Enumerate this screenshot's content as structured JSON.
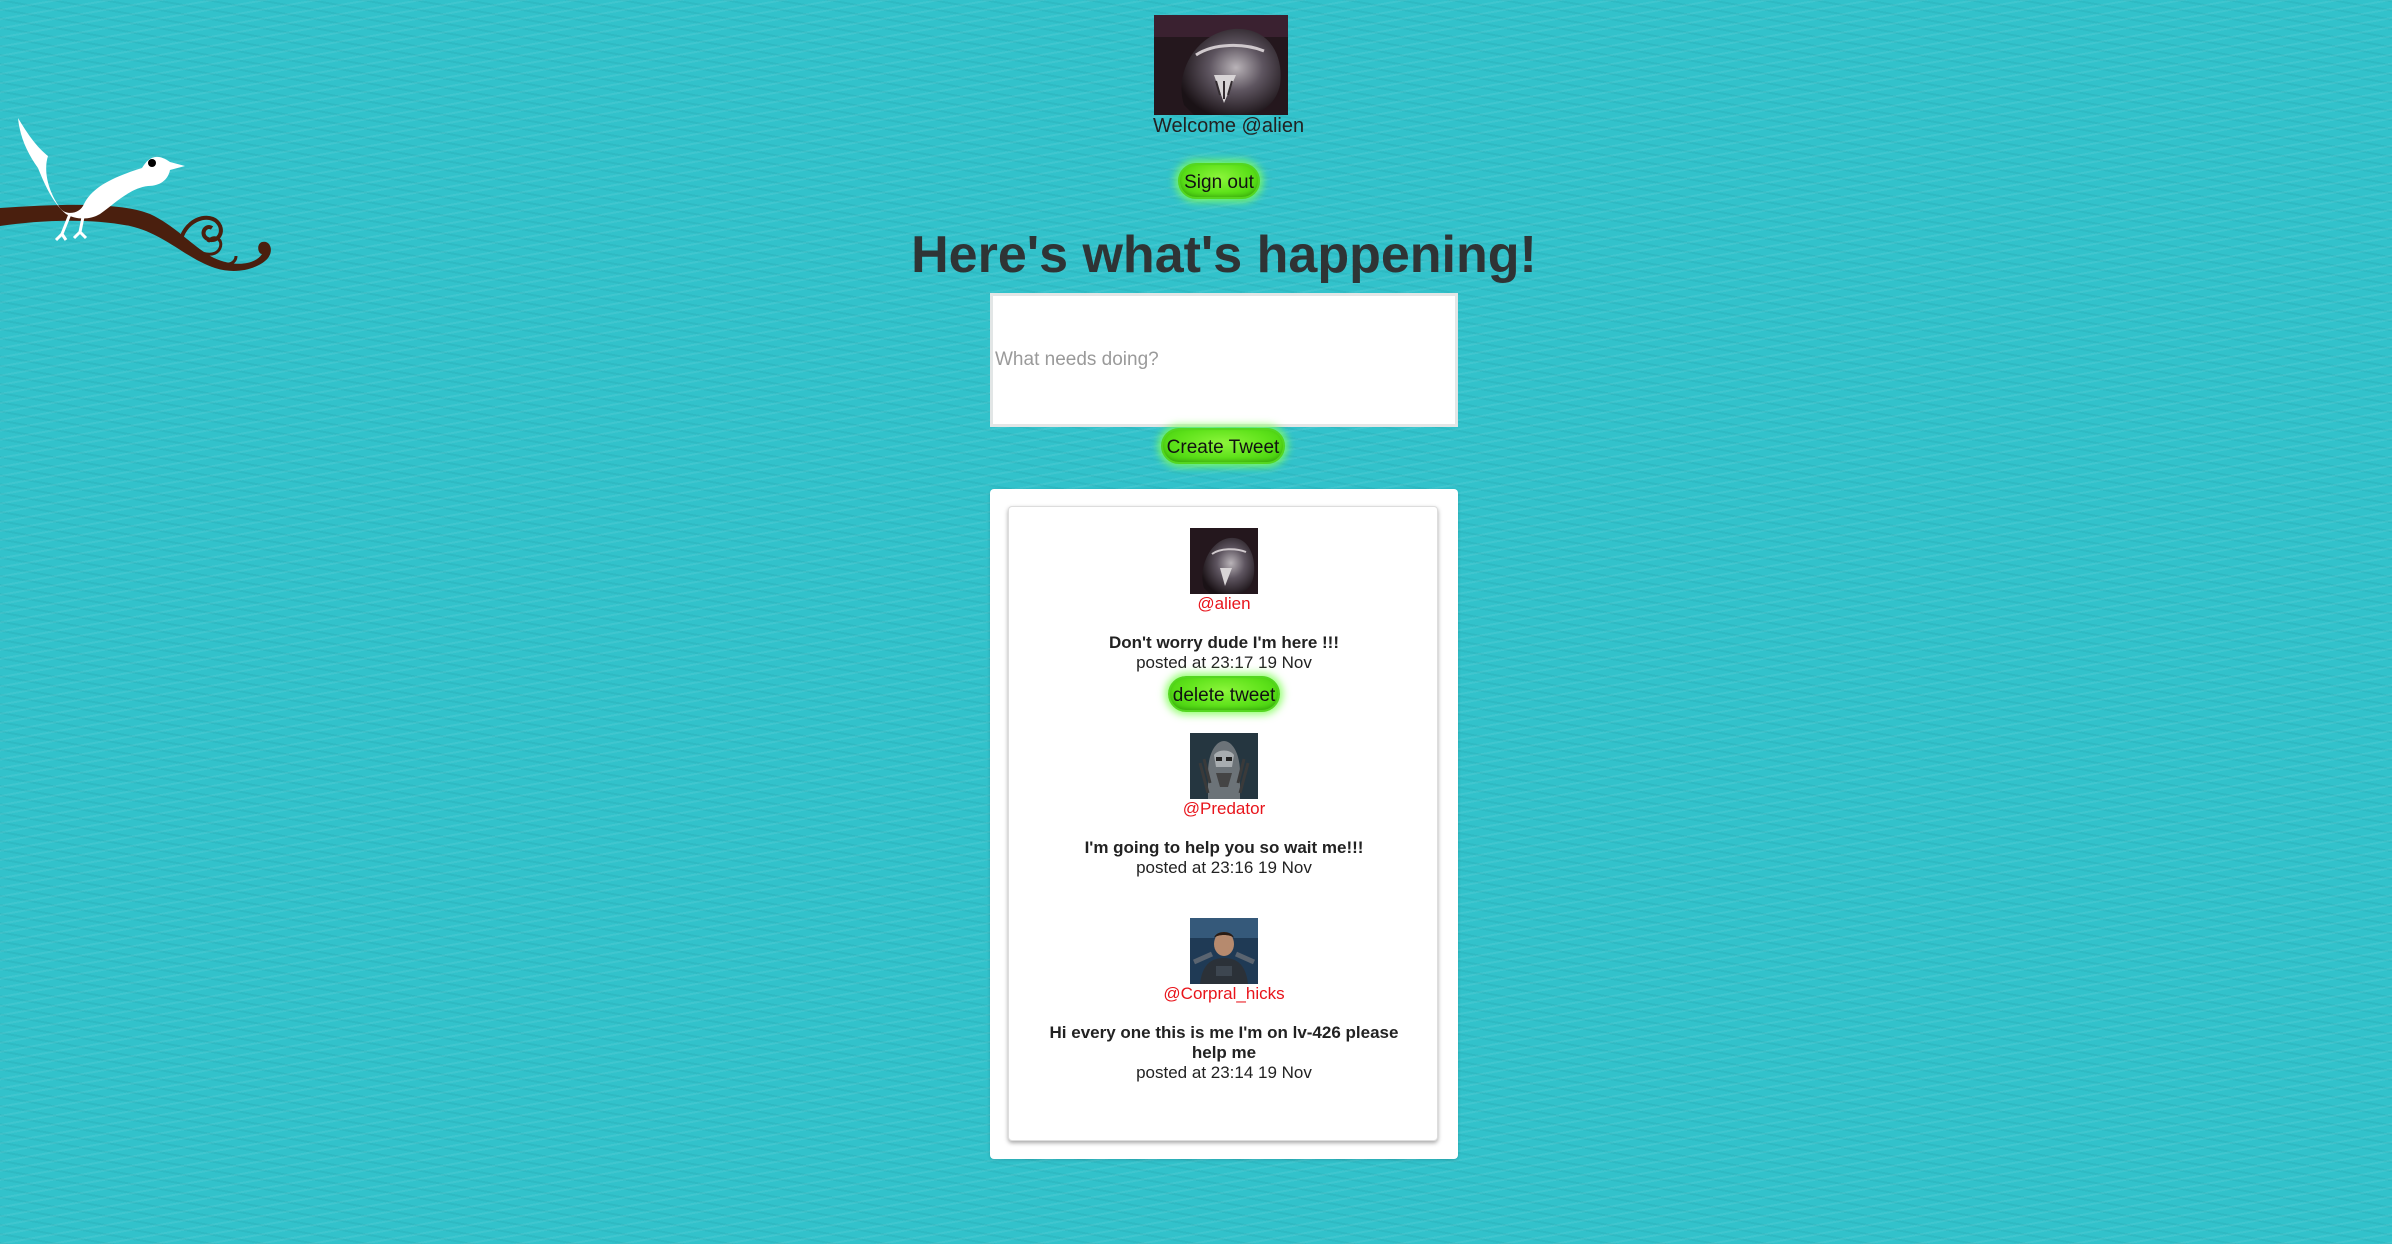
{
  "header": {
    "welcome_text": "Welcome @alien",
    "sign_out_label": "Sign out"
  },
  "main": {
    "headline": "Here's what's happening!",
    "compose_placeholder": "What needs doing?",
    "create_label": "Create Tweet"
  },
  "feed": {
    "tweets": [
      {
        "handle": "@alien",
        "text": "Don't worry dude I'm here !!!",
        "meta": "posted at 23:17 19 Nov",
        "delete_label": "delete tweet",
        "avatar": "alien-avatar"
      },
      {
        "handle": "@Predator",
        "text": "I'm going to help you so wait me!!!",
        "meta": "posted at 23:16 19 Nov",
        "avatar": "predator-avatar"
      },
      {
        "handle": "@Corpral_hicks",
        "text": "Hi every one this is me I'm on lv-426 please help me",
        "meta": "posted at 23:14 19 Nov",
        "avatar": "hicks-avatar"
      }
    ]
  },
  "colors": {
    "background": "#32c2cb",
    "button_green": "#5ee21a",
    "handle_red": "#e8141b",
    "headline": "#2f3435"
  }
}
